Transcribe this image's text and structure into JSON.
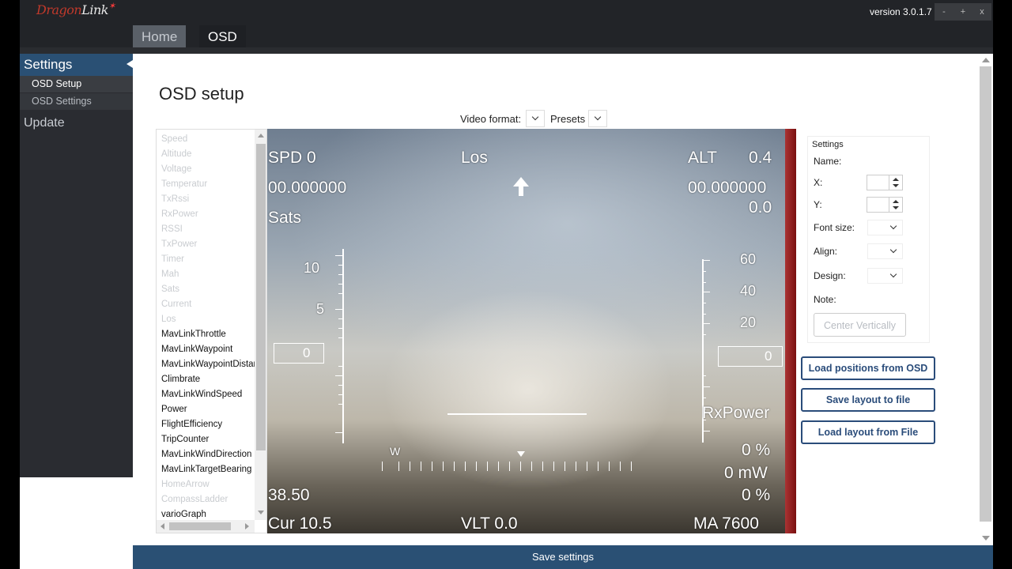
{
  "app": {
    "logo_brand": "Dragon",
    "logo_link": "Link",
    "logo_star": "✶",
    "version": "version 3.0.1.7",
    "window_buttons": [
      "-",
      "+",
      "x"
    ]
  },
  "tabs": [
    {
      "label": "Home",
      "active": false
    },
    {
      "label": "OSD",
      "active": true
    }
  ],
  "sidebar": {
    "section": "Settings",
    "items": [
      "OSD Setup",
      "OSD Settings"
    ],
    "update": "Update"
  },
  "page": {
    "title": "OSD setup",
    "video_format_label": "Video format:",
    "presets_label": "Presets"
  },
  "element_list": {
    "disabled": [
      "Speed",
      "Altitude",
      "Voltage",
      "Temperatur",
      "TxRssi",
      "RxPower",
      "RSSI",
      "TxPower",
      "Timer",
      "Mah",
      "Sats",
      "Current",
      "Los"
    ],
    "enabled": [
      "MavLinkThrottle",
      "MavLinkWaypoint",
      "MavLinkWaypointDistar",
      "Climbrate",
      "MavLinkWindSpeed",
      "Power",
      "FlightEfficiency",
      "TripCounter",
      "MavLinkWindDirection",
      "MavLinkTargetBearing"
    ],
    "disabled_bottom": [
      "HomeArrow",
      "CompassLadder"
    ],
    "enabled_bottom": [
      "varioGraph"
    ]
  },
  "osd": {
    "spd": "SPD  0",
    "los": "Los",
    "alt_label": "ALT",
    "alt_value": "0.4",
    "coord_left": "00.000000",
    "coord_right": "00.000000",
    "right_value": "0.0",
    "sats": "Sats",
    "left_ladder": [
      "10",
      "5",
      "0"
    ],
    "right_ladder": [
      "60",
      "40",
      "20",
      "0"
    ],
    "rxpower": "RxPower",
    "pct1": "0 %",
    "mw": "0 mW",
    "pct2": "0 %",
    "bottom_left_value": "38.50",
    "cur": "Cur 10.5",
    "vlt": "VLT  0.0",
    "ma": "MA  7600",
    "compass_letter": "W"
  },
  "settings": {
    "title": "Settings",
    "name": "Name:",
    "x": "X:",
    "y": "Y:",
    "font_size": "Font size:",
    "align": "Align:",
    "design": "Design:",
    "note": "Note:",
    "center_vertically": "Center Vertically"
  },
  "actions": {
    "load_positions": "Load positions from OSD",
    "save_layout": "Save layout to file",
    "load_layout": "Load layout from File"
  },
  "footer": {
    "save_settings": "Save settings"
  }
}
